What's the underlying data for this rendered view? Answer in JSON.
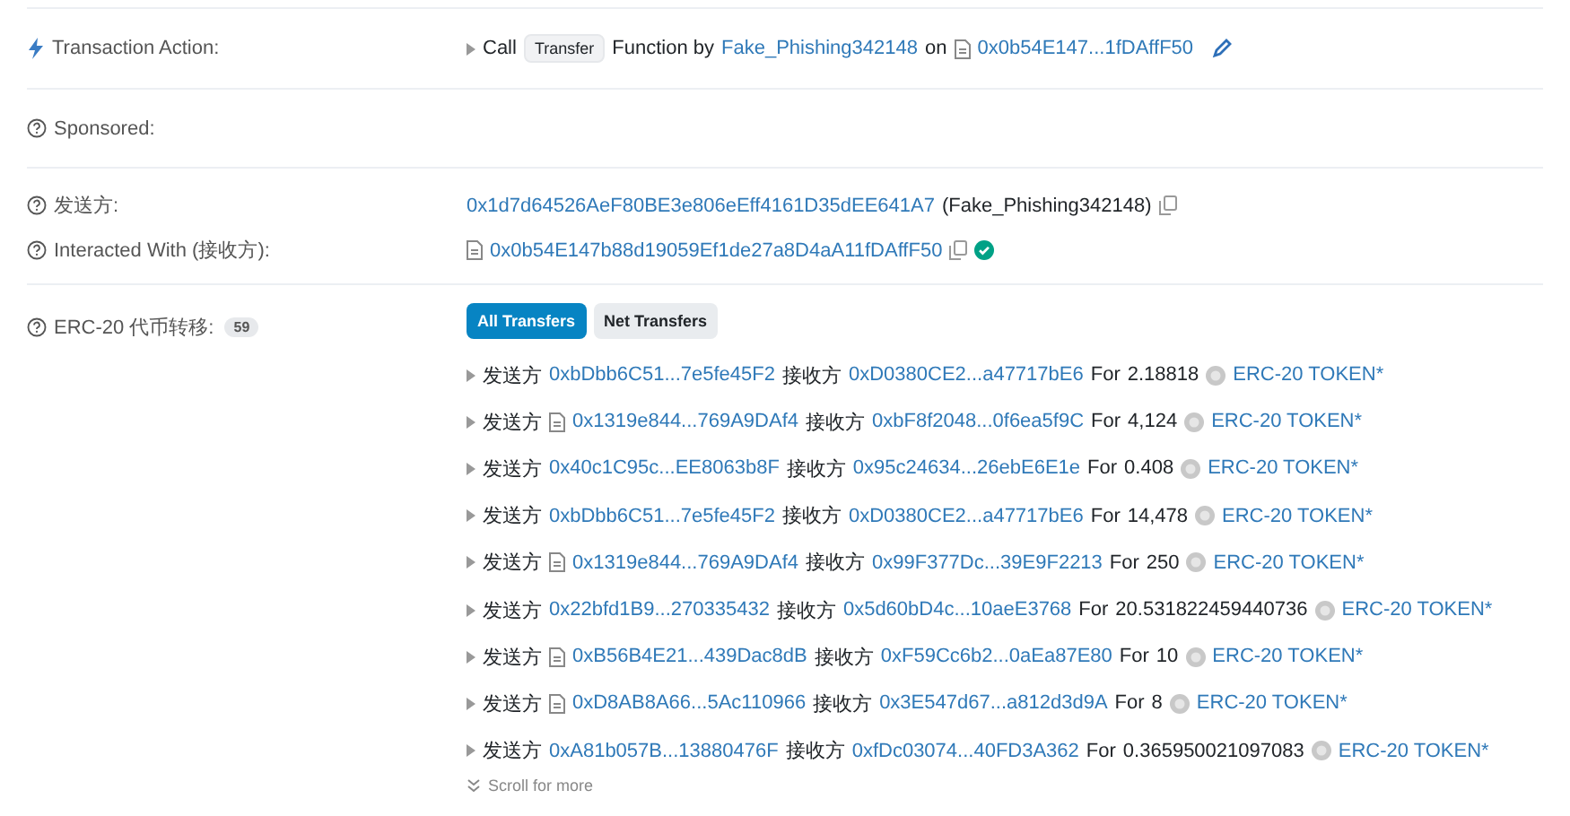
{
  "transaction_action": {
    "label": "Transaction Action:",
    "call": "Call",
    "function": "Transfer",
    "function_by": "Function by",
    "caller": "Fake_Phishing342148",
    "on": "on",
    "contract": "0x0b54E147...1fDAffF50"
  },
  "sponsored": {
    "label": "Sponsored:"
  },
  "from": {
    "label": "发送方:",
    "address": "0x1d7d64526AeF80BE3e806eEff4161D35dEE641A7",
    "name": "(Fake_Phishing342148)"
  },
  "interacted_with": {
    "label": "Interacted With (接收方):",
    "address": "0x0b54E147b88d19059Ef1de27a8D4aA11fDAffF50",
    "verified": true
  },
  "erc20_transfers": {
    "label": "ERC-20 代币转移:",
    "count": "59",
    "tabs": [
      {
        "label": "All Transfers",
        "selected": true
      },
      {
        "label": "Net Transfers",
        "selected": false
      }
    ],
    "rows": [
      {
        "from_label": "发送方",
        "from": "0xbDbb6C51...7e5fe45F2",
        "from_contract": false,
        "to_label": "接收方",
        "to": "0xD0380CE2...a47717bE6",
        "for_label": "For",
        "amount": "2.18818",
        "token": "ERC-20 TOKEN*"
      },
      {
        "from_label": "发送方",
        "from": "0x1319e844...769A9DAf4",
        "from_contract": true,
        "to_label": "接收方",
        "to": "0xbF8f2048...0f6ea5f9C",
        "for_label": "For",
        "amount": "4,124",
        "token": "ERC-20 TOKEN*"
      },
      {
        "from_label": "发送方",
        "from": "0x40c1C95c...EE8063b8F",
        "from_contract": false,
        "to_label": "接收方",
        "to": "0x95c24634...26ebE6E1e",
        "for_label": "For",
        "amount": "0.408",
        "token": "ERC-20 TOKEN*"
      },
      {
        "from_label": "发送方",
        "from": "0xbDbb6C51...7e5fe45F2",
        "from_contract": false,
        "to_label": "接收方",
        "to": "0xD0380CE2...a47717bE6",
        "for_label": "For",
        "amount": "14,478",
        "token": "ERC-20 TOKEN*"
      },
      {
        "from_label": "发送方",
        "from": "0x1319e844...769A9DAf4",
        "from_contract": true,
        "to_label": "接收方",
        "to": "0x99F377Dc...39E9F2213",
        "for_label": "For",
        "amount": "250",
        "token": "ERC-20 TOKEN*"
      },
      {
        "from_label": "发送方",
        "from": "0x22bfd1B9...270335432",
        "from_contract": false,
        "to_label": "接收方",
        "to": "0x5d60bD4c...10aeE3768",
        "for_label": "For",
        "amount": "20.531822459440736",
        "token": "ERC-20 TOKEN*"
      },
      {
        "from_label": "发送方",
        "from": "0xB56B4E21...439Dac8dB",
        "from_contract": true,
        "to_label": "接收方",
        "to": "0xF59Cc6b2...0aEa87E80",
        "for_label": "For",
        "amount": "10",
        "token": "ERC-20 TOKEN*"
      },
      {
        "from_label": "发送方",
        "from": "0xD8AB8A66...5Ac110966",
        "from_contract": true,
        "to_label": "接收方",
        "to": "0x3E547d67...a812d3d9A",
        "for_label": "For",
        "amount": "8",
        "token": "ERC-20 TOKEN*"
      },
      {
        "from_label": "发送方",
        "from": "0xA81b057B...13880476F",
        "from_contract": false,
        "to_label": "接收方",
        "to": "0xfDc03074...40FD3A362",
        "for_label": "For",
        "amount": "0.365950021097083",
        "token": "ERC-20 TOKEN*"
      }
    ],
    "scroll_more": "Scroll for more"
  }
}
